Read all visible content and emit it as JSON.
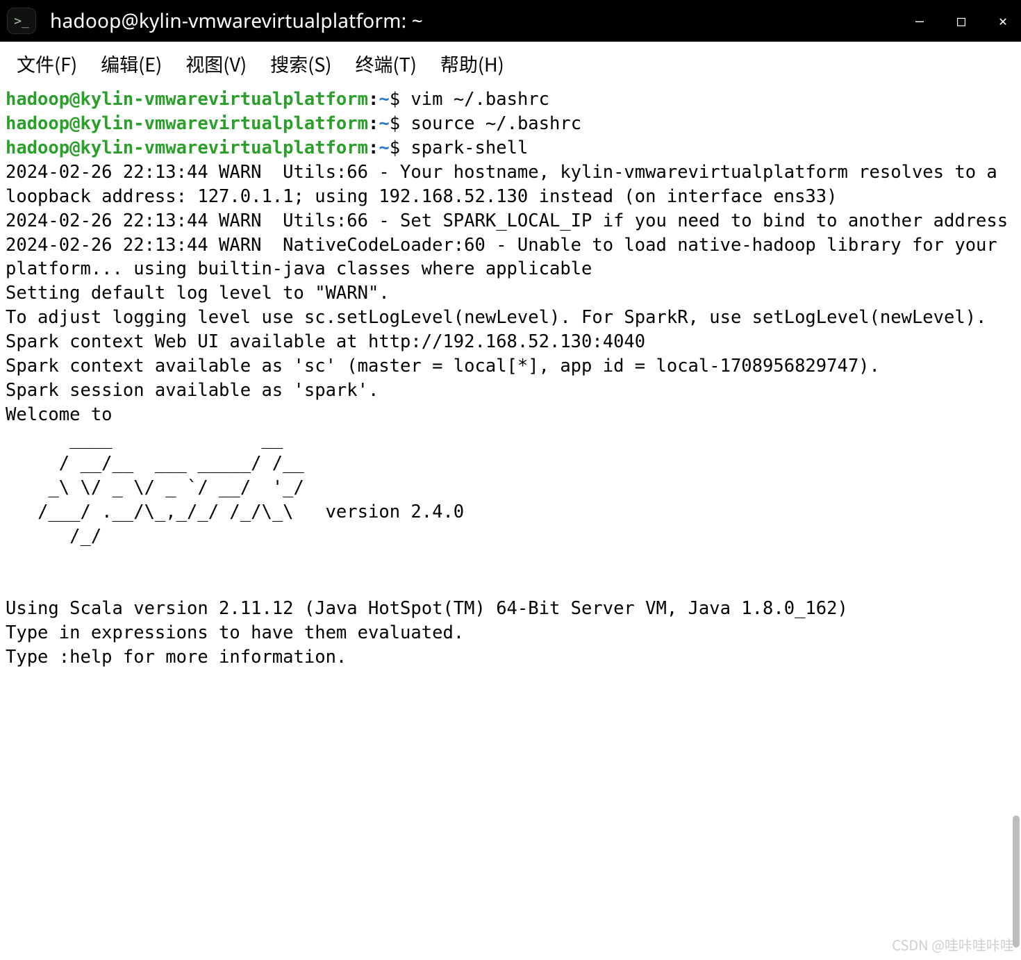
{
  "titlebar": {
    "icon_glyph": ">_",
    "title": "hadoop@kylin-vmwarevirtualplatform: ~"
  },
  "window_controls": {
    "minimize_glyph": "—",
    "maximize_glyph": "□",
    "close_glyph": "✕"
  },
  "menubar": {
    "file": "文件(F)",
    "edit": "编辑(E)",
    "view": "视图(V)",
    "search": "搜索(S)",
    "terminal": "终端(T)",
    "help": "帮助(H)"
  },
  "prompt": {
    "user_host": "hadoop@kylin-vmwarevirtualplatform",
    "colon": ":",
    "path": "~",
    "dollar": "$"
  },
  "commands": {
    "c1": " vim ~/.bashrc",
    "c2": " source ~/.bashrc",
    "c3": " spark-shell"
  },
  "output": {
    "l1": "2024-02-26 22:13:44 WARN  Utils:66 - Your hostname, kylin-vmwarevirtualplatform resolves to a loopback address: 127.0.1.1; using 192.168.52.130 instead (on interface ens33)",
    "l2": "2024-02-26 22:13:44 WARN  Utils:66 - Set SPARK_LOCAL_IP if you need to bind to another address",
    "l3": "2024-02-26 22:13:44 WARN  NativeCodeLoader:60 - Unable to load native-hadoop library for your platform... using builtin-java classes where applicable",
    "l4": "Setting default log level to \"WARN\".",
    "l5": "To adjust logging level use sc.setLogLevel(newLevel). For SparkR, use setLogLevel(newLevel).",
    "l6": "Spark context Web UI available at http://192.168.52.130:4040",
    "l7": "Spark context available as 'sc' (master = local[*], app id = local-1708956829747).",
    "l8": "Spark session available as 'spark'.",
    "l9": "Welcome to",
    "logo": "      ____              __\n     / __/__  ___ _____/ /__\n    _\\ \\/ _ \\/ _ `/ __/  '_/\n   /___/ .__/\\_,_/_/ /_/\\_\\   version 2.4.0\n      /_/\n",
    "l10": "",
    "l11": "Using Scala version 2.11.12 (Java HotSpot(TM) 64-Bit Server VM, Java 1.8.0_162)",
    "l12": "Type in expressions to have them evaluated.",
    "l13": "Type :help for more information."
  },
  "watermark": "CSDN @哇咔哇咔哇"
}
